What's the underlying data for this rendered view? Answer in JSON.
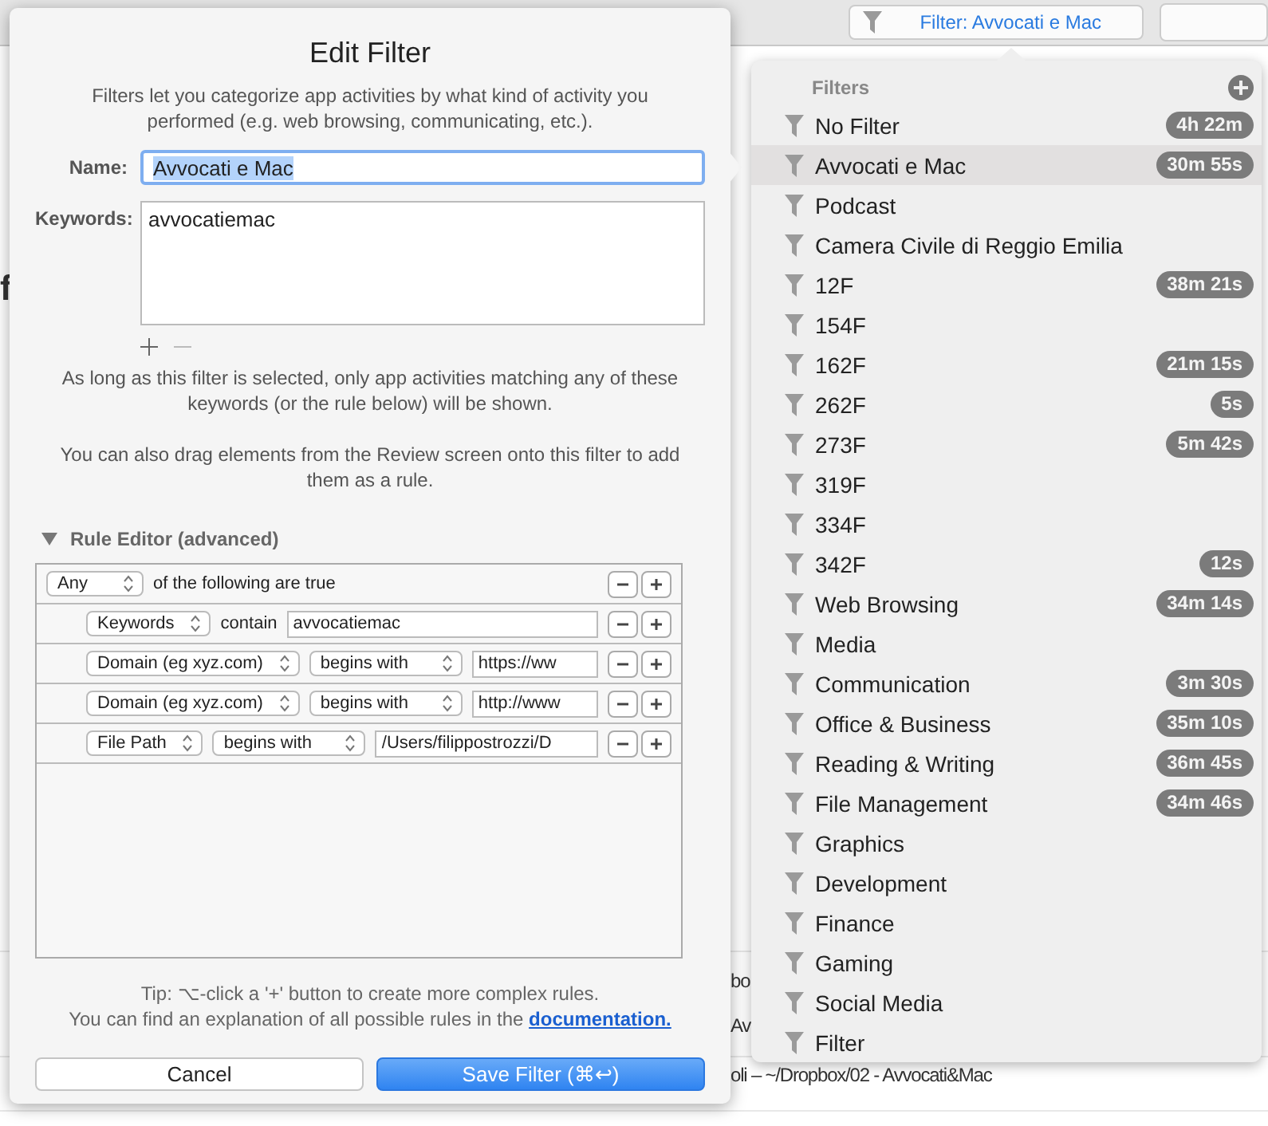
{
  "toolbar": {
    "filter_button": "Filter: Avvocati e Mac"
  },
  "background_texts": [
    {
      "text": "f",
      "kind": "heading"
    },
    {
      "text": "bo",
      "kind": "row"
    },
    {
      "text": "Av",
      "kind": "row"
    },
    {
      "text": "oli – ~/Dropbox/02 - Avvocati&Mac",
      "kind": "row"
    }
  ],
  "dialog": {
    "title": "Edit Filter",
    "description": "Filters let you categorize app activities by what kind of activity you performed (e.g. web browsing, communicating, etc.).",
    "name_label": "Name:",
    "name_value": "Avvocati e Mac",
    "name_text_selected": true,
    "keywords_label": "Keywords:",
    "keywords_value": "avvocatiemac",
    "keywords_hint": "As long as this filter is selected, only app activities matching any of these keywords (or the rule below) will be shown.",
    "drag_hint": "You can also drag elements from the Review screen onto this filter to add them as a rule.",
    "rule_editor": {
      "title": "Rule Editor (advanced)",
      "expanded": true,
      "rows": [
        {
          "kind": "header",
          "field": "Any",
          "operator": "of the following are true"
        },
        {
          "kind": "text_operator",
          "field": "Keywords",
          "operator": "contain",
          "value": "avvocatiemac"
        },
        {
          "kind": "popup_operator",
          "field": "Domain (eg xyz.com)",
          "operator": "begins with",
          "value": "https://ww"
        },
        {
          "kind": "popup_operator",
          "field": "Domain (eg xyz.com)",
          "operator": "begins with",
          "value": "http://www"
        },
        {
          "kind": "popup_operator",
          "field": "File Path",
          "operator": "begins with",
          "value": "/Users/filippostrozzi/D"
        }
      ]
    },
    "tip": "Tip: ⌥-click a '+' button to create more complex rules.",
    "help_text": "You can find an explanation of all possible rules in the",
    "help_link": "documentation.",
    "buttons": [
      {
        "label": "Cancel",
        "kind": "secondary"
      },
      {
        "label": "Save Filter (⌘↩)",
        "kind": "primary"
      }
    ]
  },
  "filters_popover": {
    "title": "Filters",
    "items": [
      {
        "label": "No Filter",
        "badge": "4h 22m",
        "selected": false
      },
      {
        "label": "Avvocati e Mac",
        "badge": "30m 55s",
        "selected": true
      },
      {
        "label": "Podcast",
        "selected": false
      },
      {
        "label": "Camera Civile di Reggio Emilia",
        "selected": false
      },
      {
        "label": "12F",
        "badge": "38m 21s",
        "selected": false
      },
      {
        "label": "154F",
        "selected": false
      },
      {
        "label": "162F",
        "badge": "21m 15s",
        "selected": false
      },
      {
        "label": "262F",
        "badge": "5s",
        "selected": false
      },
      {
        "label": "273F",
        "badge": "5m 42s",
        "selected": false
      },
      {
        "label": "319F",
        "selected": false
      },
      {
        "label": "334F",
        "selected": false
      },
      {
        "label": "342F",
        "badge": "12s",
        "selected": false
      },
      {
        "label": "Web Browsing",
        "badge": "34m 14s",
        "selected": false
      },
      {
        "label": "Media",
        "selected": false
      },
      {
        "label": "Communication",
        "badge": "3m 30s",
        "selected": false
      },
      {
        "label": "Office & Business",
        "badge": "35m 10s",
        "selected": false
      },
      {
        "label": "Reading & Writing",
        "badge": "36m 45s",
        "selected": false
      },
      {
        "label": "File Management",
        "badge": "34m 46s",
        "selected": false
      },
      {
        "label": "Graphics",
        "selected": false
      },
      {
        "label": "Development",
        "selected": false
      },
      {
        "label": "Finance",
        "selected": false
      },
      {
        "label": "Gaming",
        "selected": false
      },
      {
        "label": "Social Media",
        "selected": false
      },
      {
        "label": "Filter",
        "selected": false
      }
    ]
  }
}
